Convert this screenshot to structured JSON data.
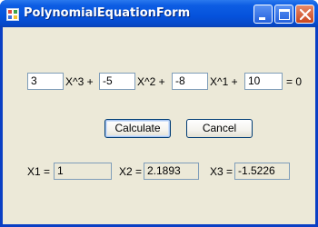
{
  "window": {
    "title": "PolynomialEquationForm"
  },
  "equation": {
    "coef3": "3",
    "label3": "X^3 +",
    "coef2": "-5",
    "label2": "X^2 +",
    "coef1": "-8",
    "label1": "X^1 +",
    "coef0": "10",
    "label0": "= 0"
  },
  "buttons": {
    "calculate": "Calculate",
    "cancel": "Cancel"
  },
  "results": {
    "x1_label": "X1 =",
    "x1_value": "1",
    "x2_label": "X2 =",
    "x2_value": "2.1893",
    "x3_label": "X3 =",
    "x3_value": "-1.5226"
  },
  "colors": {
    "titlebar": "#0552dc",
    "client": "#ece9d8",
    "close_button": "#c9461e"
  }
}
